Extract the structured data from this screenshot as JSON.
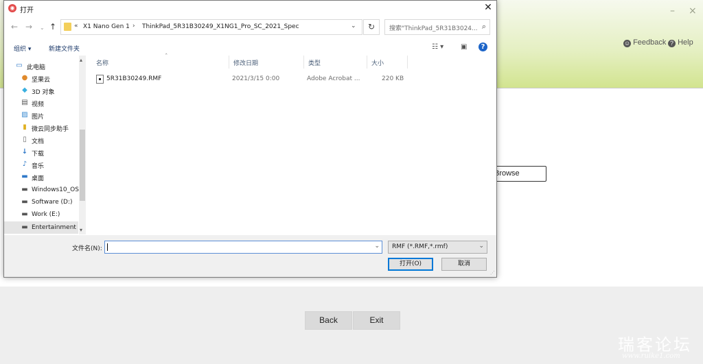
{
  "app": {
    "minimize": "–",
    "close": "×",
    "feedback_label": "Feedback",
    "help_label": "Help",
    "browse_label": "Browse",
    "back_label": "Back",
    "exit_label": "Exit"
  },
  "watermark": {
    "title": "瑞客论坛",
    "url": "www.ruike1.com"
  },
  "dialog": {
    "title": "打开",
    "close": "✕",
    "breadcrumb": {
      "overflow": "«",
      "items": [
        "X1 Nano Gen 1",
        "ThinkPad_5R31B30249_X1NG1_Pro_SC_2021_Spec"
      ],
      "separator": "›"
    },
    "search_placeholder": "搜索\"ThinkPad_5R31B3024...",
    "toolbar": {
      "organize": "组织 ▾",
      "new_folder": "新建文件夹"
    },
    "nav_items": [
      {
        "label": "此电脑",
        "icon": "computer-icon"
      },
      {
        "label": "坚果云",
        "icon": "nutstore-icon"
      },
      {
        "label": "3D 对象",
        "icon": "3d-objects-icon"
      },
      {
        "label": "视频",
        "icon": "video-icon"
      },
      {
        "label": "图片",
        "icon": "pictures-icon"
      },
      {
        "label": "微云同步助手",
        "icon": "weiyun-icon"
      },
      {
        "label": "文档",
        "icon": "documents-icon"
      },
      {
        "label": "下载",
        "icon": "download-icon"
      },
      {
        "label": "音乐",
        "icon": "music-icon"
      },
      {
        "label": "桌面",
        "icon": "desktop-icon"
      },
      {
        "label": "Windows10_OS",
        "icon": "drive-icon"
      },
      {
        "label": "Software (D:)",
        "icon": "drive-icon"
      },
      {
        "label": "Work (E:)",
        "icon": "drive-icon"
      },
      {
        "label": "Entertainment",
        "icon": "drive-icon"
      }
    ],
    "columns": {
      "name": "名称",
      "modified": "修改日期",
      "type": "类型",
      "size": "大小"
    },
    "files": [
      {
        "name": "5R31B30249.RMF",
        "modified": "2021/3/15 0:00",
        "type": "Adobe Acrobat ...",
        "size": "220 KB"
      }
    ],
    "filename_label": "文件名(N):",
    "filename_value": "",
    "filetype_value": "RMF (*.RMF,*.rmf)",
    "open_label": "打开(O)",
    "cancel_label": "取消"
  }
}
